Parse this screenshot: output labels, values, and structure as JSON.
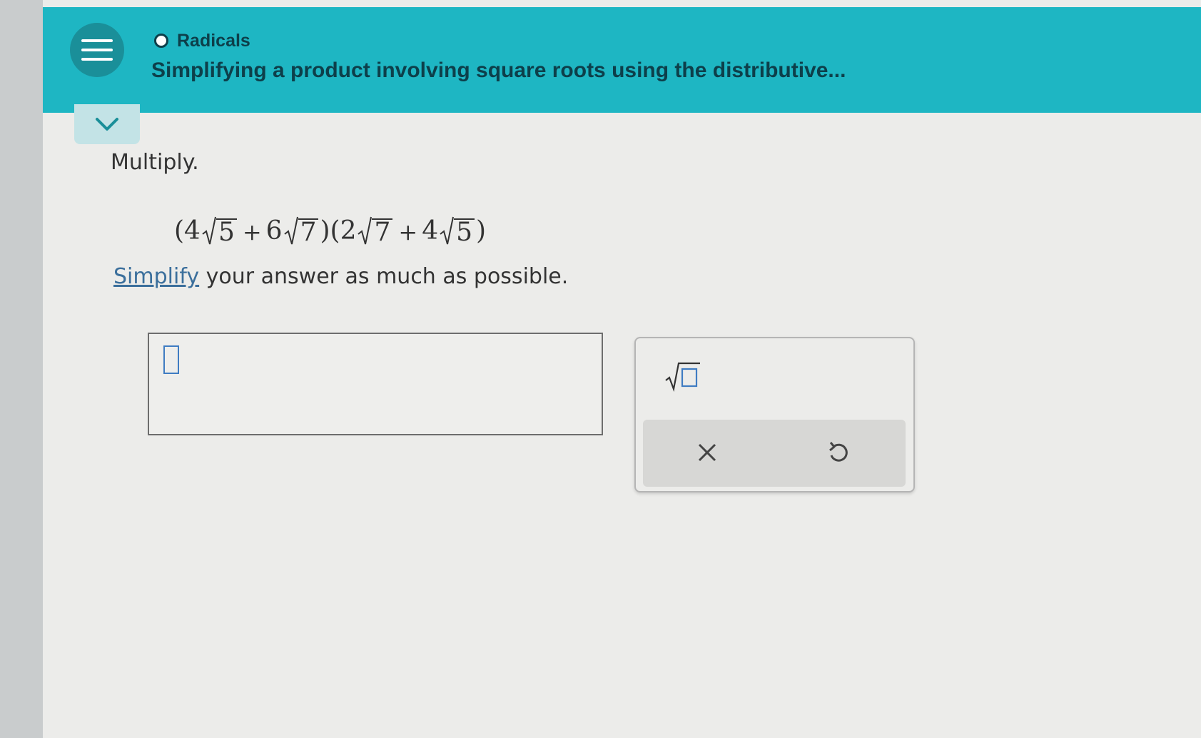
{
  "header": {
    "topic": "Radicals",
    "title": "Simplifying a product involving square roots using the distributive..."
  },
  "question": {
    "instruction": "Multiply.",
    "expression": {
      "open1": "(",
      "coef1": "4",
      "rad1": "5",
      "op1": "+",
      "coef2": "6",
      "rad2": "7",
      "close1": ")",
      "open2": "(",
      "coef3": "2",
      "rad3": "7",
      "op2": "+",
      "coef4": "4",
      "rad4": "5",
      "close2": ")"
    },
    "simplify_link": "Simplify",
    "simplify_rest": " your answer as much as possible."
  },
  "answer": {
    "value": ""
  },
  "keypad": {
    "keys": [
      "square-root"
    ],
    "actions": [
      "clear",
      "undo"
    ]
  },
  "colors": {
    "header": "#1eb6c3",
    "menu_button": "#1a8f99",
    "link": "#3b6f9c",
    "cursor": "#3f7cc2"
  }
}
